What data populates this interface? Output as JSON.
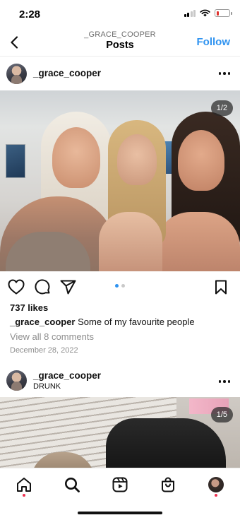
{
  "status_bar": {
    "time": "2:28"
  },
  "header": {
    "username": "_GRACE_COOPER",
    "title": "Posts",
    "follow_label": "Follow"
  },
  "post1": {
    "username": "_grace_cooper",
    "image_counter": "1/2",
    "likes": "737 likes",
    "caption_user": "_grace_cooper",
    "caption_text": " Some of my favourite people",
    "comments_link": "View all 8 comments",
    "date": "December 28, 2022",
    "carousel_pages": 2,
    "carousel_active": 1
  },
  "post2": {
    "username": "_grace_cooper",
    "subtitle": "DRUNK",
    "image_counter": "1/5"
  },
  "colors": {
    "accent": "#2f93f0",
    "notification_dot": "#ee2f4e",
    "battery_low": "#e0342f"
  },
  "icons": {
    "back": "chevron-left-icon",
    "more": "more-horizontal-icon",
    "like": "heart-icon",
    "comment": "comment-bubble-icon",
    "share": "paper-plane-icon",
    "save": "bookmark-icon",
    "tab_home": "home-icon",
    "tab_search": "search-icon",
    "tab_reels": "reels-icon",
    "tab_shop": "shop-bag-icon",
    "tab_profile": "profile-avatar-icon"
  }
}
